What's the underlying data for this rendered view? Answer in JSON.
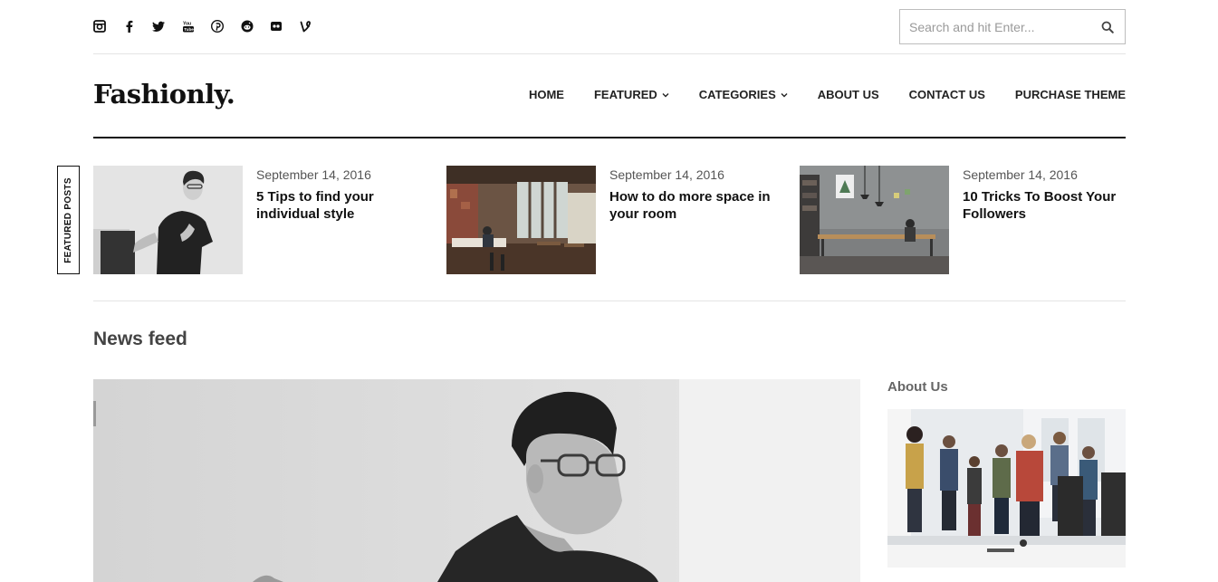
{
  "social": {
    "icons": [
      "instagram-icon",
      "facebook-icon",
      "twitter-icon",
      "youtube-icon",
      "pinterest-icon",
      "reddit-icon",
      "flickr-icon",
      "vine-icon"
    ]
  },
  "search": {
    "placeholder": "Search and hit Enter..."
  },
  "header": {
    "logo": "Fashionly.",
    "nav": {
      "home": "HOME",
      "featured": "FEATURED",
      "categories": "CATEGORIES",
      "about": "ABOUT US",
      "contact": "CONTACT US",
      "purchase": "PURCHASE THEME"
    }
  },
  "featured": {
    "tag": "FEATURED POSTS",
    "posts": [
      {
        "date": "September 14, 2016",
        "title": "5 Tips to find your individual style"
      },
      {
        "date": "September 14, 2016",
        "title": "How to do more space in your room"
      },
      {
        "date": "September 14, 2016",
        "title": "10 Tricks To Boost Your Followers"
      }
    ]
  },
  "main": {
    "newsfeed_title": "News feed"
  },
  "sidebar": {
    "about_title": "About Us"
  },
  "colors": {
    "text": "#111111",
    "muted": "#555555",
    "border": "#e5e5e5",
    "accent_rule": "#111111"
  }
}
